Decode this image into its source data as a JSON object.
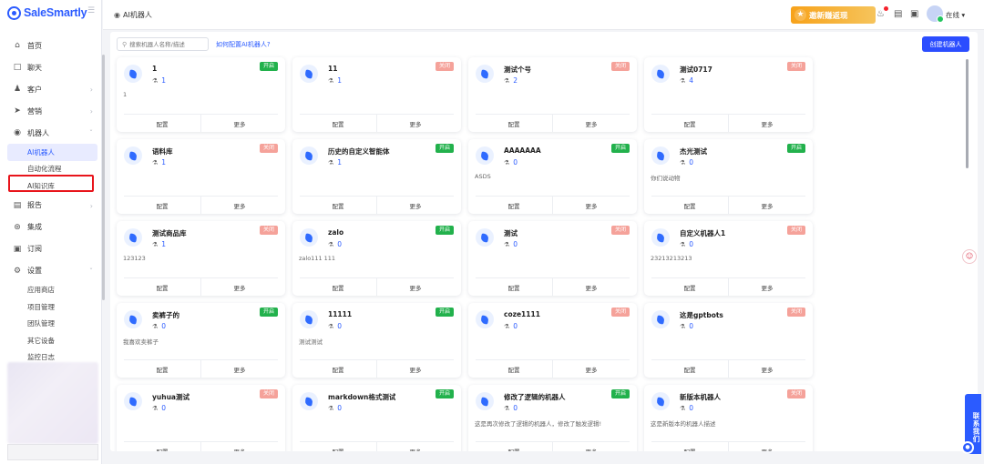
{
  "app": {
    "name": "SaleSmartly",
    "brand_color": "#2b5bff"
  },
  "sidebar": {
    "menu": [
      {
        "label": "首页",
        "icon": "home-icon"
      },
      {
        "label": "聊天",
        "icon": "chat-icon"
      },
      {
        "label": "客户",
        "icon": "users-icon"
      },
      {
        "label": "营销",
        "icon": "send-icon"
      },
      {
        "label": "机器人",
        "icon": "robot-icon"
      },
      {
        "label": "报告",
        "icon": "chart-icon"
      },
      {
        "label": "集成",
        "icon": "integration-icon"
      },
      {
        "label": "订阅",
        "icon": "subscription-icon"
      },
      {
        "label": "设置",
        "icon": "settings-icon"
      }
    ],
    "robot_sub": [
      "AI机器人",
      "自动化流程",
      "AI知识库"
    ],
    "settings_sub": [
      "应用商店",
      "项目管理",
      "团队管理",
      "其它设备",
      "监控日志"
    ]
  },
  "topbar": {
    "breadcrumb": "AI机器人",
    "promo": "邀新赚返现",
    "status": "在线"
  },
  "toolbar": {
    "search_placeholder": "搜索机器人名称/描述",
    "help_link": "如何配置AI机器人?",
    "create_button": "创建机器人"
  },
  "labels": {
    "config": "配置",
    "more": "更多",
    "on": "开启",
    "off": "关闭"
  },
  "cards": [
    {
      "name": "1",
      "count": "1",
      "status": "开启",
      "on": true,
      "desc": "1"
    },
    {
      "name": "11",
      "count": "1",
      "status": "关闭",
      "on": false,
      "desc": ""
    },
    {
      "name": "测试个号",
      "count": "2",
      "status": "关闭",
      "on": false,
      "desc": ""
    },
    {
      "name": "测试0717",
      "count": "4",
      "status": "关闭",
      "on": false,
      "desc": ""
    },
    {
      "name": "语料库",
      "count": "1",
      "status": "关闭",
      "on": false,
      "desc": ""
    },
    {
      "name": "历史的自定义智能体",
      "count": "1",
      "status": "开启",
      "on": true,
      "desc": ""
    },
    {
      "name": "AAAAAAA",
      "count": "0",
      "status": "开启",
      "on": true,
      "desc": "ASDS"
    },
    {
      "name": "杰光测试",
      "count": "0",
      "status": "开启",
      "on": true,
      "desc": "你们说动物"
    },
    {
      "name": "测试商品库",
      "count": "1",
      "status": "关闭",
      "on": false,
      "desc": "123123"
    },
    {
      "name": "zalo",
      "count": "0",
      "status": "开启",
      "on": true,
      "desc": "zalo111 111"
    },
    {
      "name": "测试",
      "count": "0",
      "status": "关闭",
      "on": false,
      "desc": ""
    },
    {
      "name": "自定义机器人1",
      "count": "0",
      "status": "关闭",
      "on": false,
      "desc": "23213213213"
    },
    {
      "name": "卖裤子的",
      "count": "0",
      "status": "开启",
      "on": true,
      "desc": "我喜欢卖裤子"
    },
    {
      "name": "11111",
      "count": "0",
      "status": "开启",
      "on": true,
      "desc": "测试测试"
    },
    {
      "name": "coze1111",
      "count": "0",
      "status": "关闭",
      "on": false,
      "desc": ""
    },
    {
      "name": "这是gptbots",
      "count": "0",
      "status": "关闭",
      "on": false,
      "desc": ""
    },
    {
      "name": "yuhua测试",
      "count": "0",
      "status": "关闭",
      "on": false,
      "desc": ""
    },
    {
      "name": "markdown格式测试",
      "count": "0",
      "status": "开启",
      "on": true,
      "desc": ""
    },
    {
      "name": "修改了逻辑的机器人",
      "count": "0",
      "status": "开启",
      "on": true,
      "desc": "这是再次修改了逻辑的机器人，修改了触发逻辑!"
    },
    {
      "name": "新版本机器人",
      "count": "0",
      "status": "关闭",
      "on": false,
      "desc": "这是新版本的机器人描述"
    }
  ],
  "floating": {
    "contact": "联系我们"
  }
}
